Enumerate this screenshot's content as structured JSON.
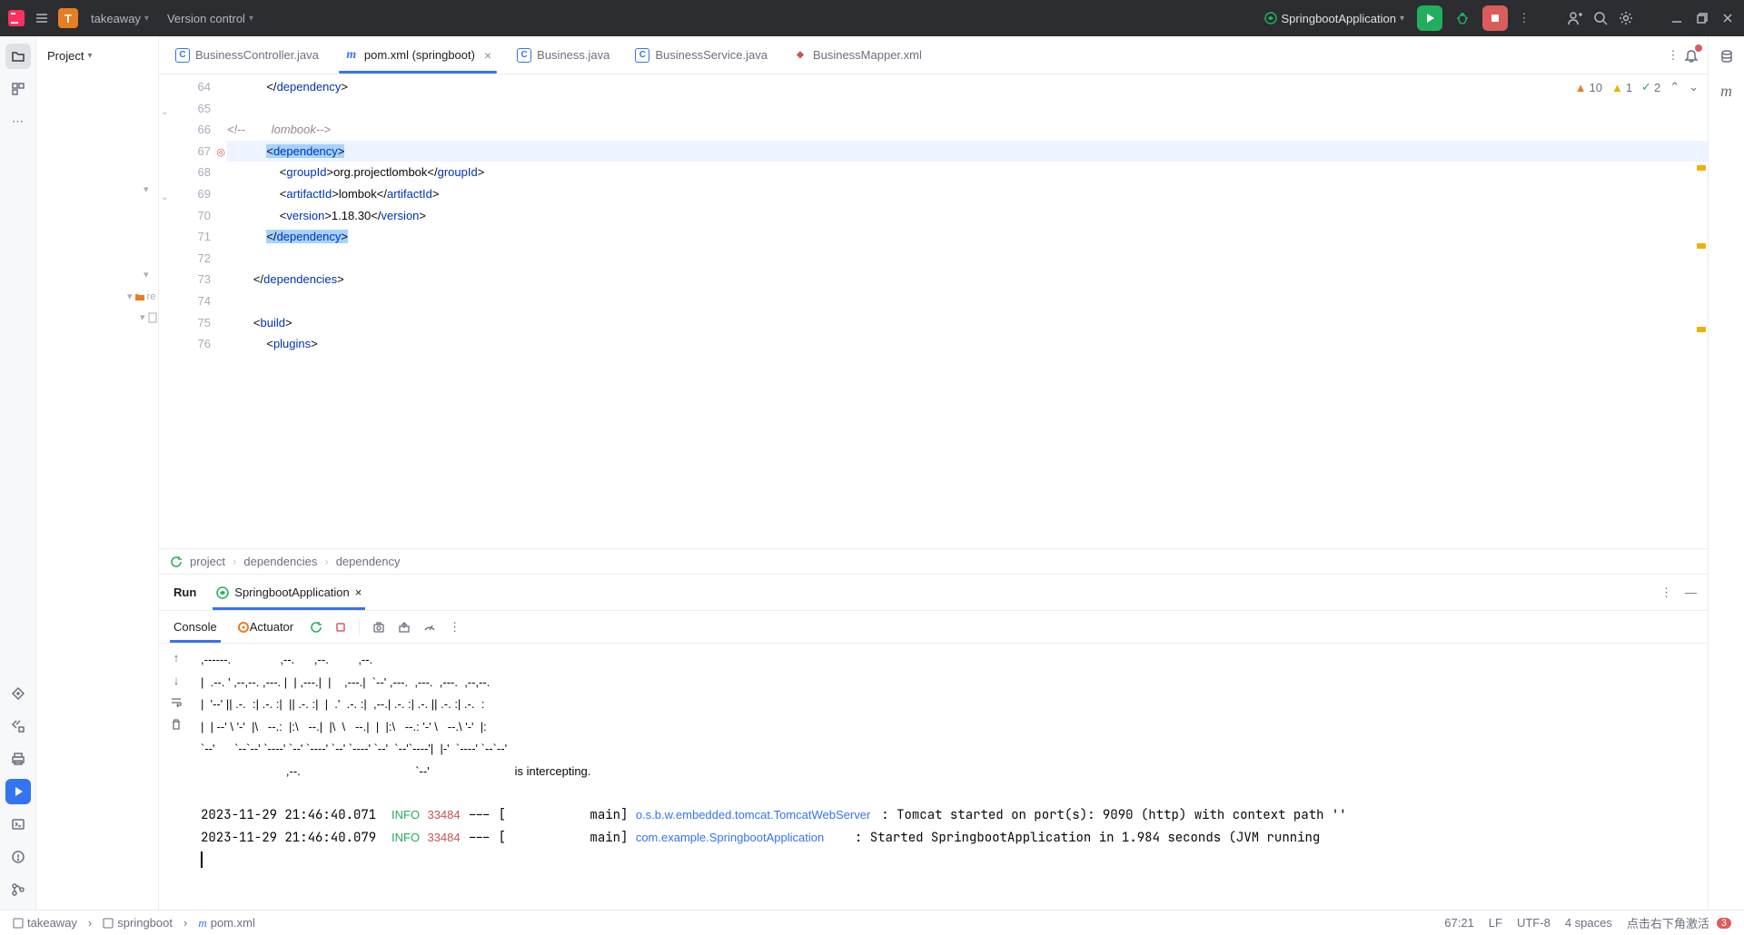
{
  "titlebar": {
    "project_initial": "T",
    "project_name": "takeaway",
    "vcs": "Version control",
    "run_config": "SpringbootApplication"
  },
  "project_tool": "Project",
  "tabs": [
    {
      "label": "BusinessController.java",
      "type": "java",
      "active": false
    },
    {
      "label": "pom.xml (springboot)",
      "type": "maven",
      "active": true
    },
    {
      "label": "Business.java",
      "type": "java",
      "active": false
    },
    {
      "label": "BusinessService.java",
      "type": "java",
      "active": false
    },
    {
      "label": "BusinessMapper.xml",
      "type": "xml",
      "active": false
    }
  ],
  "inspections": {
    "error": "10",
    "warn": "1",
    "typo": "2"
  },
  "code": {
    "lines": [
      {
        "n": 64,
        "pre": "            ",
        "tokens": [
          [
            "</",
            "txt"
          ],
          [
            "dependency",
            "tag"
          ],
          [
            ">",
            "txt"
          ]
        ]
      },
      {
        "n": 65,
        "pre": "",
        "tokens": []
      },
      {
        "n": 66,
        "pre": "",
        "tokens": [
          [
            "<!--        lombook-->",
            "com"
          ]
        ]
      },
      {
        "n": 67,
        "pre": "            ",
        "hl": true,
        "sel": true,
        "tokens": [
          [
            "<",
            "txt"
          ],
          [
            "dependency",
            "tag"
          ],
          [
            ">",
            "txt"
          ]
        ]
      },
      {
        "n": 68,
        "pre": "                ",
        "tokens": [
          [
            "<",
            "txt"
          ],
          [
            "groupId",
            "tag"
          ],
          [
            ">",
            "txt"
          ],
          [
            "org.projectlombok",
            "txt"
          ],
          [
            "</",
            "txt"
          ],
          [
            "groupId",
            "tag"
          ],
          [
            ">",
            "txt"
          ]
        ]
      },
      {
        "n": 69,
        "pre": "                ",
        "tokens": [
          [
            "<",
            "txt"
          ],
          [
            "artifactId",
            "tag"
          ],
          [
            ">",
            "txt"
          ],
          [
            "lombok",
            "txt"
          ],
          [
            "</",
            "txt"
          ],
          [
            "artifactId",
            "tag"
          ],
          [
            ">",
            "txt"
          ]
        ]
      },
      {
        "n": 70,
        "pre": "                ",
        "tokens": [
          [
            "<",
            "txt"
          ],
          [
            "version",
            "tag"
          ],
          [
            ">",
            "txt"
          ],
          [
            "1.18.30",
            "txt"
          ],
          [
            "</",
            "txt"
          ],
          [
            "version",
            "tag"
          ],
          [
            ">",
            "txt"
          ]
        ]
      },
      {
        "n": 71,
        "pre": "            ",
        "sel": true,
        "tokens": [
          [
            "</",
            "txt"
          ],
          [
            "dependency",
            "tag"
          ],
          [
            ">",
            "txt"
          ]
        ]
      },
      {
        "n": 72,
        "pre": "",
        "tokens": []
      },
      {
        "n": 73,
        "pre": "        ",
        "tokens": [
          [
            "</",
            "txt"
          ],
          [
            "dependencies",
            "tag"
          ],
          [
            ">",
            "txt"
          ]
        ]
      },
      {
        "n": 74,
        "pre": "",
        "tokens": []
      },
      {
        "n": 75,
        "pre": "        ",
        "tokens": [
          [
            "<",
            "txt"
          ],
          [
            "build",
            "tag"
          ],
          [
            ">",
            "txt"
          ]
        ]
      },
      {
        "n": 76,
        "pre": "            ",
        "tokens": [
          [
            "<",
            "txt"
          ],
          [
            "plugins",
            "tag"
          ],
          [
            ">",
            "txt"
          ]
        ]
      }
    ]
  },
  "crumbs": [
    "project",
    "dependencies",
    "dependency"
  ],
  "run": {
    "tab_run": "Run",
    "tab_app": "SpringbootApplication",
    "tool_console": "Console",
    "tool_actuator": "Actuator"
  },
  "console": {
    "banner": ",------.               ,--.      ,--.         ,--.                                    \n|  .--. ' ,--,--. ,---. |  | ,---.|  |    ,---.|  `--' ,---.  ,---.  ,---.  ,--,--.    \n|  '--' || .-.  :| .-. :|  || .-. :|  |  .'  .-. :|  ,--.| .-. :| .-. || .-. :| .-.  :    \n|  | --' \\ '-'  |\\   --.:  |:\\   --.|  |\\  \\   --.|  |  |:\\   --.: '-' \\   --.\\ '-'  |:    \n`--'      `--`--' `----' `--' `----' `--' `----' `--'  `--'`----'|  |-'  `----' `--`--'    \n                          ,--.                                   `--'                          is intercepting.",
    "logs": [
      {
        "ts": "2023-11-29 21:46:40.071",
        "level": "INFO",
        "pid": "33484",
        "thread": "main",
        "logger": "o.s.b.w.embedded.tomcat.TomcatWebServer",
        "msg": "Tomcat started on port(s): 9090 (http) with context path ''"
      },
      {
        "ts": "2023-11-29 21:46:40.079",
        "level": "INFO",
        "pid": "33484",
        "thread": "main",
        "logger": "com.example.SpringbootApplication",
        "msg": "Started SpringbootApplication in 1.984 seconds (JVM running"
      }
    ]
  },
  "statusbar": {
    "bc1": "takeaway",
    "bc2": "springboot",
    "bc3": "pom.xml",
    "pos": "67:21",
    "sep": "LF",
    "enc": "UTF-8",
    "indent": "4 spaces",
    "activate": "点击右下角激活"
  }
}
